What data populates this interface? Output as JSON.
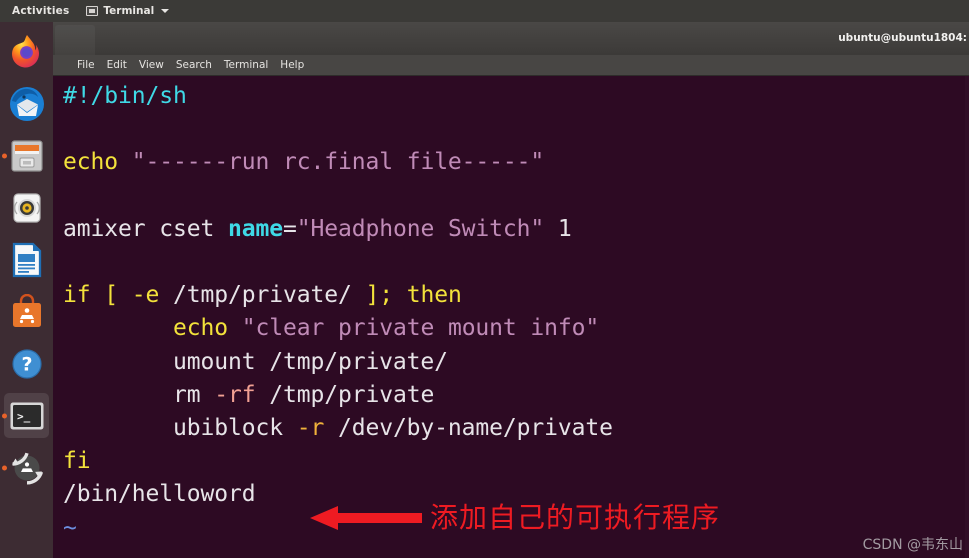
{
  "topbar": {
    "activities": "Activities",
    "app_name": "Terminal",
    "app_icon": "terminal-window-icon",
    "caret_icon": "chevron-down-icon"
  },
  "dock": {
    "items": [
      {
        "name": "firefox",
        "label": "Firefox",
        "running": false,
        "active": false
      },
      {
        "name": "thunderbird",
        "label": "Thunderbird Mail",
        "running": false,
        "active": false
      },
      {
        "name": "files",
        "label": "Files",
        "running": true,
        "active": false
      },
      {
        "name": "rhythmbox",
        "label": "Rhythmbox",
        "running": false,
        "active": false
      },
      {
        "name": "libreoffice-writer",
        "label": "LibreOffice Writer",
        "running": false,
        "active": false
      },
      {
        "name": "ubuntu-software",
        "label": "Ubuntu Software",
        "running": false,
        "active": false
      },
      {
        "name": "help",
        "label": "Help",
        "running": false,
        "active": false
      },
      {
        "name": "terminal",
        "label": "Terminal",
        "running": true,
        "active": true
      },
      {
        "name": "software-updater",
        "label": "Software Updater",
        "running": true,
        "active": false
      }
    ]
  },
  "window": {
    "title": "ubuntu@ubuntu1804:",
    "menus": [
      "File",
      "Edit",
      "View",
      "Search",
      "Terminal",
      "Help"
    ]
  },
  "terminal": {
    "colors": {
      "background": "#2d0a23",
      "white": "#e7e4e8",
      "cyan": "#3fd9e6",
      "yellow": "#f3e23b",
      "mauve": "#c08bb7",
      "salmon": "#f1a193",
      "orange": "#f0b23b",
      "blue": "#6d8fe0"
    },
    "lines": [
      {
        "tokens": [
          {
            "t": "#!/bin/sh",
            "c": "c-cyan"
          }
        ]
      },
      {
        "tokens": [
          {
            "t": "",
            "c": "c-white"
          }
        ]
      },
      {
        "tokens": [
          {
            "t": "echo",
            "c": "c-yellow"
          },
          {
            "t": " ",
            "c": "c-white"
          },
          {
            "t": "\"------run rc.final file-----\"",
            "c": "c-mauve"
          }
        ]
      },
      {
        "tokens": [
          {
            "t": "",
            "c": "c-white"
          }
        ]
      },
      {
        "tokens": [
          {
            "t": "amixer cset ",
            "c": "c-white"
          },
          {
            "t": "name",
            "c": "c-cyan b"
          },
          {
            "t": "=",
            "c": "c-white"
          },
          {
            "t": "\"Headphone Switch\"",
            "c": "c-mauve"
          },
          {
            "t": " 1",
            "c": "c-white"
          }
        ]
      },
      {
        "tokens": [
          {
            "t": "",
            "c": "c-white"
          }
        ]
      },
      {
        "tokens": [
          {
            "t": "if",
            "c": "c-yellow"
          },
          {
            "t": " ",
            "c": "c-white"
          },
          {
            "t": "[",
            "c": "c-yellow"
          },
          {
            "t": " ",
            "c": "c-white"
          },
          {
            "t": "-e",
            "c": "c-yellow"
          },
          {
            "t": " /tmp/private/ ",
            "c": "c-white"
          },
          {
            "t": "];",
            "c": "c-yellow"
          },
          {
            "t": " ",
            "c": "c-white"
          },
          {
            "t": "then",
            "c": "c-yellow"
          }
        ]
      },
      {
        "tokens": [
          {
            "t": "        ",
            "c": "c-white"
          },
          {
            "t": "echo",
            "c": "c-yellow"
          },
          {
            "t": " ",
            "c": "c-white"
          },
          {
            "t": "\"clear private mount info\"",
            "c": "c-mauve"
          }
        ]
      },
      {
        "tokens": [
          {
            "t": "        umount /tmp/private/",
            "c": "c-white"
          }
        ]
      },
      {
        "tokens": [
          {
            "t": "        rm ",
            "c": "c-white"
          },
          {
            "t": "-rf",
            "c": "c-salmon"
          },
          {
            "t": " /tmp/private",
            "c": "c-white"
          }
        ]
      },
      {
        "tokens": [
          {
            "t": "        ubiblock ",
            "c": "c-white"
          },
          {
            "t": "-r",
            "c": "c-orange"
          },
          {
            "t": " /dev/by-name/private",
            "c": "c-white"
          }
        ]
      },
      {
        "tokens": [
          {
            "t": "fi",
            "c": "c-yellow"
          }
        ]
      },
      {
        "tokens": [
          {
            "t": "/bin/helloword",
            "c": "c-white"
          }
        ]
      },
      {
        "tokens": [
          {
            "t": "~",
            "c": "c-blue"
          }
        ]
      }
    ]
  },
  "annotation": {
    "arrow_icon": "left-arrow-annotation-icon",
    "arrow_color": "#ee1b22",
    "text": "添加自己的可执行程序"
  },
  "watermark": {
    "text": "CSDN @韦东山"
  }
}
